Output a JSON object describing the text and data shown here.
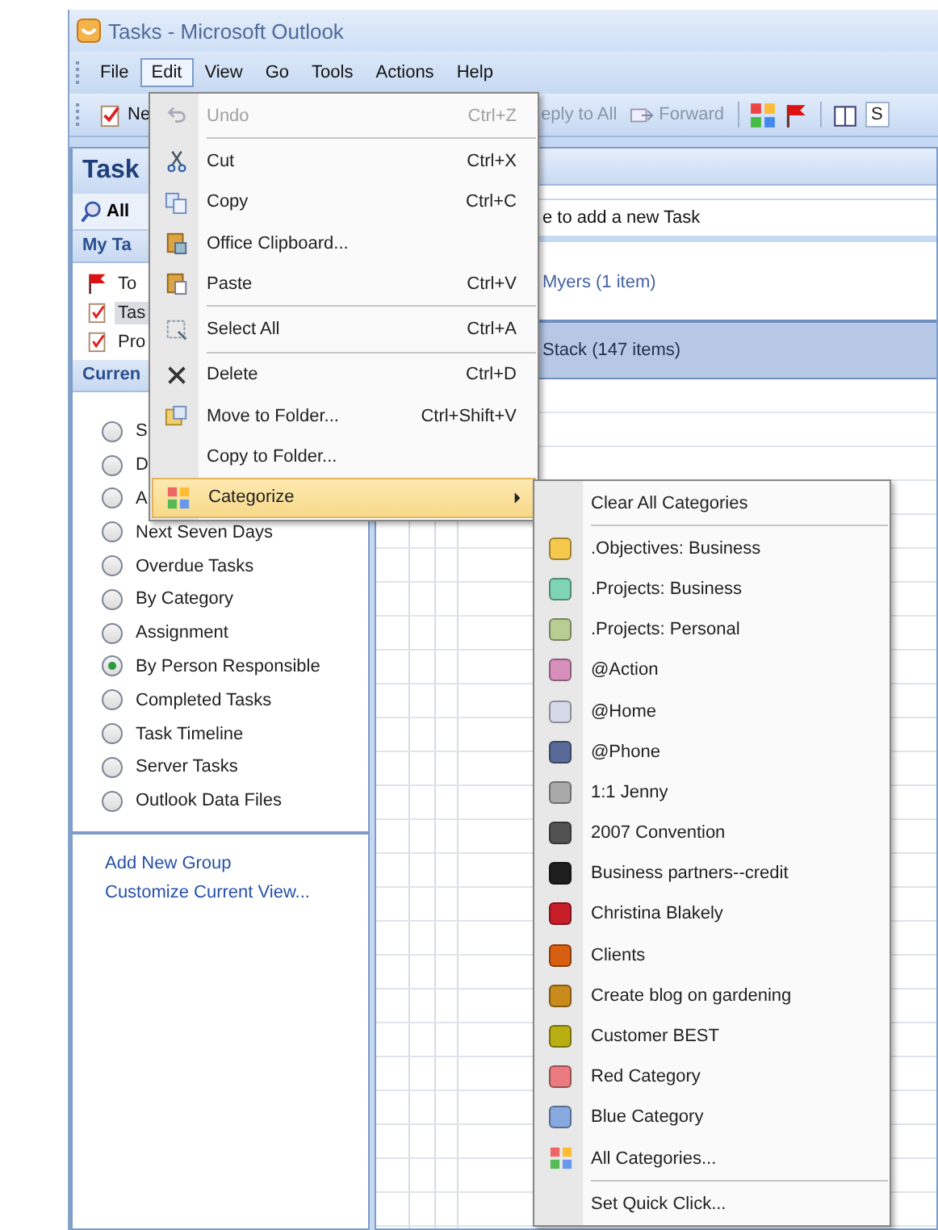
{
  "window": {
    "title": "Tasks - Microsoft Outlook"
  },
  "menu_bar": [
    {
      "label": "File",
      "selected": false
    },
    {
      "label": "Edit",
      "selected": true
    },
    {
      "label": "View",
      "selected": false
    },
    {
      "label": "Go",
      "selected": false
    },
    {
      "label": "Tools",
      "selected": false
    },
    {
      "label": "Actions",
      "selected": false
    },
    {
      "label": "Help",
      "selected": false
    }
  ],
  "toolbar": {
    "new": "Ne",
    "reply_all": "eply to All",
    "forward": "Forward",
    "search": "S"
  },
  "nav": {
    "title": "Task",
    "all_button": "All",
    "my_tasks": {
      "header": "My Ta",
      "items": [
        {
          "label": "To",
          "selected": false
        },
        {
          "label": "Tas",
          "selected": true
        },
        {
          "label": "Pro",
          "selected": false
        }
      ]
    },
    "current_view": {
      "header": "Curren",
      "views": [
        {
          "label": "S",
          "selected": false
        },
        {
          "label": "D",
          "selected": false
        },
        {
          "label": "A",
          "selected": false
        },
        {
          "label": "Next Seven Days",
          "selected": false
        },
        {
          "label": "Overdue Tasks",
          "selected": false
        },
        {
          "label": "By Category",
          "selected": false
        },
        {
          "label": "Assignment",
          "selected": false
        },
        {
          "label": "By Person Responsible",
          "selected": true
        },
        {
          "label": "Completed Tasks",
          "selected": false
        },
        {
          "label": "Task Timeline",
          "selected": false
        },
        {
          "label": "Server Tasks",
          "selected": false
        },
        {
          "label": "Outlook Data Files",
          "selected": false
        }
      ]
    },
    "links": [
      "Add New Group",
      "Customize Current View..."
    ]
  },
  "task_list": {
    "new_task_hint": "e to add a new Task",
    "groups": [
      {
        "label": "Myers (1 item)",
        "selected": false
      },
      {
        "label": "Stack (147 items)",
        "selected": true
      }
    ]
  },
  "edit_menu": [
    {
      "kind": "item",
      "label": "Undo",
      "shortcut": "Ctrl+Z",
      "disabled": true,
      "selected": false
    },
    {
      "kind": "separator"
    },
    {
      "kind": "item",
      "label": "Cut",
      "shortcut": "Ctrl+X",
      "disabled": false,
      "selected": false
    },
    {
      "kind": "item",
      "label": "Copy",
      "shortcut": "Ctrl+C",
      "disabled": false,
      "selected": false
    },
    {
      "kind": "item",
      "label": "Office Clipboard...",
      "disabled": false,
      "selected": false
    },
    {
      "kind": "item",
      "label": "Paste",
      "shortcut": "Ctrl+V",
      "disabled": false,
      "selected": false
    },
    {
      "kind": "separator"
    },
    {
      "kind": "item",
      "label": "Select All",
      "shortcut": "Ctrl+A",
      "disabled": false,
      "selected": false
    },
    {
      "kind": "separator"
    },
    {
      "kind": "item",
      "label": "Delete",
      "shortcut": "Ctrl+D",
      "disabled": false,
      "selected": false
    },
    {
      "kind": "item",
      "label": "Move to Folder...",
      "shortcut": "Ctrl+Shift+V",
      "disabled": false,
      "selected": false
    },
    {
      "kind": "item",
      "label": "Copy to Folder...",
      "disabled": false,
      "selected": false
    },
    {
      "kind": "submenu",
      "label": "Categorize",
      "disabled": false,
      "selected": true
    }
  ],
  "categorize_menu": [
    {
      "kind": "action",
      "label": "Clear All Categories"
    },
    {
      "kind": "separator"
    },
    {
      "kind": "category",
      "label": ".Objectives: Business",
      "color": "#f6c84c"
    },
    {
      "kind": "category",
      "label": ".Projects: Business",
      "color": "#7fd4b4"
    },
    {
      "kind": "category",
      "label": ".Projects: Personal",
      "color": "#b8cd92"
    },
    {
      "kind": "category",
      "label": "@Action",
      "color": "#d88fbc"
    },
    {
      "kind": "category",
      "label": "@Home",
      "color": "#d6d9e8"
    },
    {
      "kind": "category",
      "label": "@Phone",
      "color": "#586a98"
    },
    {
      "kind": "category",
      "label": "1:1 Jenny",
      "color": "#a9a9a9"
    },
    {
      "kind": "category",
      "label": "2007 Convention",
      "color": "#525252"
    },
    {
      "kind": "category",
      "label": "Business partners--credit",
      "color": "#1e1e1e"
    },
    {
      "kind": "category",
      "label": "Christina Blakely",
      "color": "#c81e2a"
    },
    {
      "kind": "category",
      "label": "Clients",
      "color": "#d85f12"
    },
    {
      "kind": "category",
      "label": "Create blog on gardening",
      "color": "#c98b1c"
    },
    {
      "kind": "category",
      "label": "Customer BEST",
      "color": "#b8b012"
    },
    {
      "kind": "category",
      "label": "Red Category",
      "color": "#ea7b80"
    },
    {
      "kind": "category",
      "label": "Blue Category",
      "color": "#88a9e0"
    },
    {
      "kind": "all",
      "label": "All Categories..."
    },
    {
      "kind": "separator"
    },
    {
      "kind": "action",
      "label": "Set Quick Click..."
    }
  ]
}
